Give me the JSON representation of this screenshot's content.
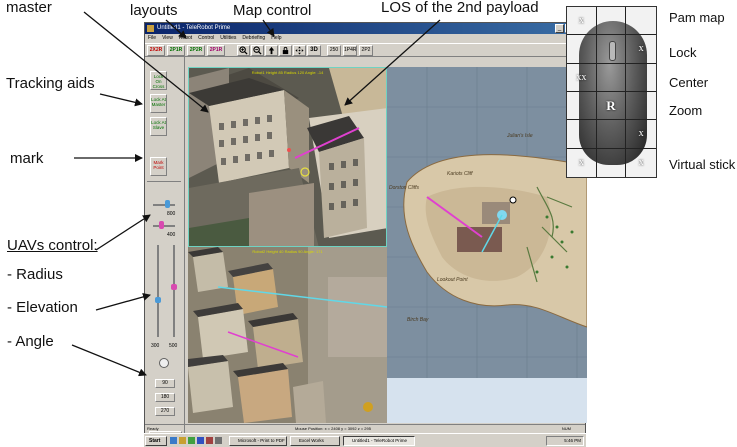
{
  "annotations": {
    "master": "master",
    "layouts": "layouts",
    "map_control": "Map control",
    "los": "LOS of the 2nd payload",
    "tracking_aids": "Tracking aids",
    "mark": "mark",
    "uav_control": "UAVs control:",
    "radius": "- Radius",
    "elevation": "- Elevation",
    "angle": "- Angle",
    "pam_map": "Pam map",
    "lock": "Lock",
    "center": "Center",
    "zoom": "Zoom",
    "virtual_stick": "Virtual stick"
  },
  "mouse_map": {
    "cells": [
      "x",
      "",
      "",
      "",
      "",
      "x",
      "xx",
      "",
      "",
      "",
      "R",
      "",
      "",
      "",
      "x",
      "x",
      "",
      "x"
    ]
  },
  "window": {
    "title": "Untitled1 - TeleRobot Prime",
    "menu": [
      "File",
      "View",
      "Robot",
      "Control",
      "Utilities",
      "Debriefing",
      "Help"
    ],
    "layout_buttons": [
      "2X2R",
      "2P1R",
      "2P2R",
      "2P1R"
    ],
    "zoom_level": "250",
    "layout_view_buttons": [
      "1P4R",
      "2P2"
    ],
    "left_buttons": [
      {
        "label": "Lock On Cross"
      },
      {
        "label": "Lock At Master"
      },
      {
        "label": "Lock At Slave"
      },
      {
        "label": "Mark Point"
      }
    ],
    "sliders": {
      "radius_top": "800",
      "radius_mid": "400",
      "elev_left": "300",
      "elev_right": "500"
    },
    "angle_buttons": [
      "90",
      "180",
      "270"
    ],
    "toggle_label": "Toggle Control",
    "view_label_master": "Robot1 Height 85 Radius 120 Angle: -14",
    "view_label_second": "Robot2 Height 40 Radius 90 Angle: 171",
    "map_labels": {
      "julians": "Julian's Isle",
      "kariots": "Kariots Cliff",
      "dorston": "Dorston Cliffs",
      "lookout": "Lookout Point",
      "birch": "Birch Bay"
    },
    "status": {
      "left": "Ready",
      "mid": "Mouse Position: x = 2408 y = 3092 z = 295",
      "right": "NUM"
    },
    "taskbar": {
      "start": "Start",
      "tasks": [
        "Microsoft - Print to PDF",
        "Excel Works",
        "Untitled1 - TeleRobot Prime"
      ],
      "clock": "5:46 PM"
    }
  }
}
